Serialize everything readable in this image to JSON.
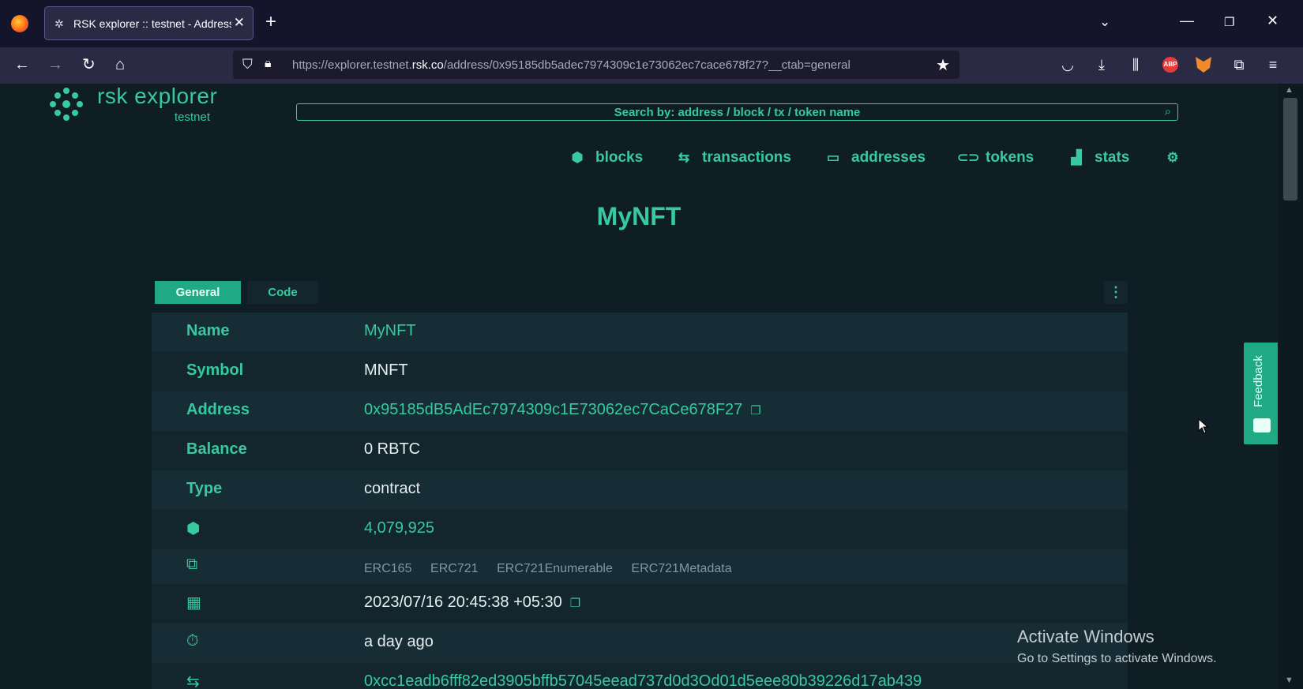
{
  "browser": {
    "tab_title": "RSK explorer :: testnet - Address",
    "url_prefix": "https://explorer.testnet.",
    "url_domain": "rsk.co",
    "url_path": "/address/0x95185db5adec7974309c1e73062ec7cace678f27?__ctab=general"
  },
  "header": {
    "logo_title": "rsk explorer",
    "logo_subtitle": "testnet",
    "search_placeholder": "Search by: address / block / tx / token name"
  },
  "nav": {
    "items": [
      {
        "label": "blocks",
        "icon": "cube-icon"
      },
      {
        "label": "transactions",
        "icon": "arrows-icon"
      },
      {
        "label": "addresses",
        "icon": "card-icon"
      },
      {
        "label": "tokens",
        "icon": "link-icon"
      },
      {
        "label": "stats",
        "icon": "chart-icon"
      }
    ],
    "settings_icon": "gear-icon"
  },
  "page": {
    "title": "MyNFT",
    "tabs": [
      "General",
      "Code"
    ]
  },
  "details": {
    "name_label": "Name",
    "name_value": "MyNFT",
    "symbol_label": "Symbol",
    "symbol_value": "MNFT",
    "address_label": "Address",
    "address_value": "0x95185dB5AdEc7974309c1E73062ec7CaCe678F27",
    "balance_label": "Balance",
    "balance_value": "0 RBTC",
    "type_label": "Type",
    "type_value": "contract",
    "block_value": "4,079,925",
    "interfaces": [
      "ERC165",
      "ERC721",
      "ERC721Enumerable",
      "ERC721Metadata"
    ],
    "created_value": "2023/07/16 20:45:38 +05:30",
    "age_value": "a day ago",
    "tx_partial": "0xcc1eadb6fff82ed3905bffb57045eead737d0d3Od01d5eee80b39226d17ab439"
  },
  "feedback_label": "Feedback",
  "watermark": {
    "line1": "Activate Windows",
    "line2": "Go to Settings to activate Windows."
  },
  "colors": {
    "accent": "#37c9a0",
    "accent_dark": "#1faa85",
    "background": "#0f1e24"
  }
}
